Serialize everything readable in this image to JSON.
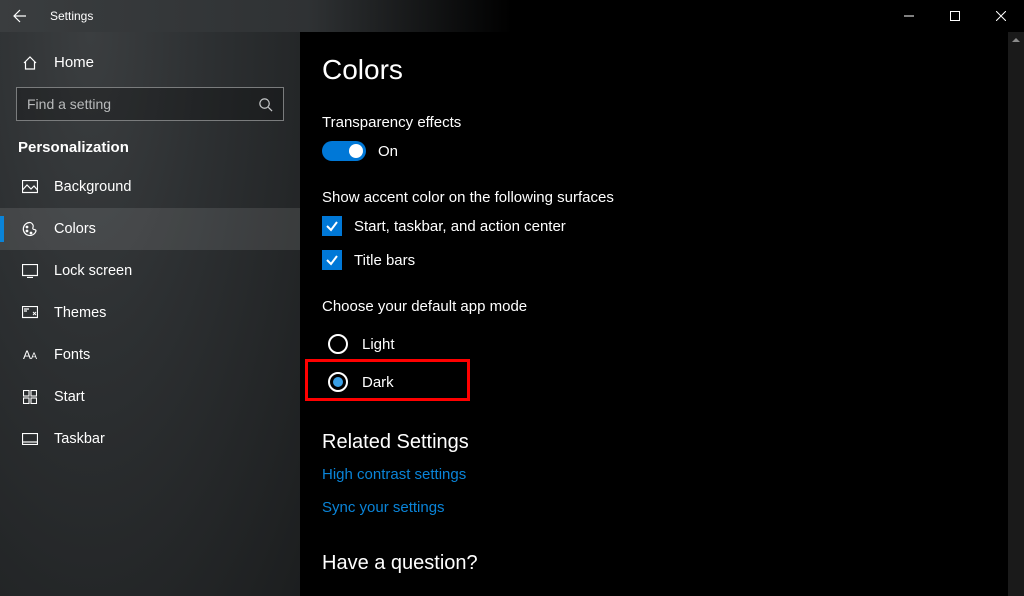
{
  "titlebar": {
    "title": "Settings"
  },
  "sidebar": {
    "home_label": "Home",
    "search_placeholder": "Find a setting",
    "category": "Personalization",
    "items": [
      {
        "label": "Background",
        "icon": "picture",
        "selected": false
      },
      {
        "label": "Colors",
        "icon": "palette",
        "selected": true
      },
      {
        "label": "Lock screen",
        "icon": "lockscreen",
        "selected": false
      },
      {
        "label": "Themes",
        "icon": "themes",
        "selected": false
      },
      {
        "label": "Fonts",
        "icon": "fonts",
        "selected": false
      },
      {
        "label": "Start",
        "icon": "start",
        "selected": false
      },
      {
        "label": "Taskbar",
        "icon": "taskbar",
        "selected": false
      }
    ]
  },
  "main": {
    "page_title": "Colors",
    "transparency": {
      "heading": "Transparency effects",
      "state_label": "On",
      "on": true
    },
    "accent_surfaces": {
      "heading": "Show accent color on the following surfaces",
      "options": [
        {
          "label": "Start, taskbar, and action center",
          "checked": true
        },
        {
          "label": "Title bars",
          "checked": true
        }
      ]
    },
    "app_mode": {
      "heading": "Choose your default app mode",
      "options": [
        {
          "label": "Light",
          "selected": false,
          "highlighted": false
        },
        {
          "label": "Dark",
          "selected": true,
          "highlighted": true
        }
      ]
    },
    "related": {
      "heading": "Related Settings",
      "links": [
        {
          "label": "High contrast settings"
        },
        {
          "label": "Sync your settings"
        }
      ]
    },
    "question_heading": "Have a question?"
  },
  "colors": {
    "accent": "#0078d7",
    "link": "#0a84d8",
    "highlight_border": "#ff0000"
  }
}
